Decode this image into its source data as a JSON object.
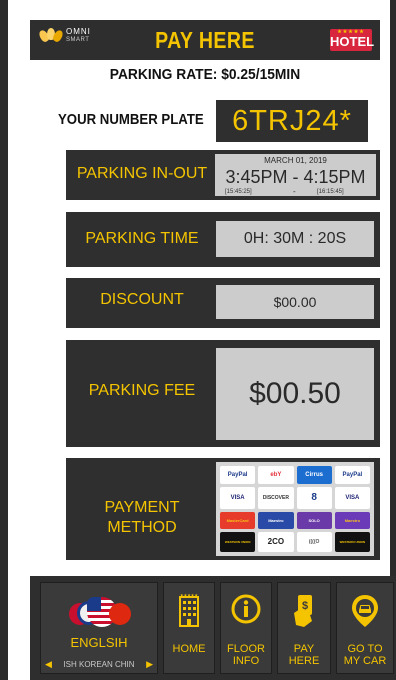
{
  "header": {
    "brand_top": "OMNI",
    "brand_bottom": "SMART",
    "title": "PAY HERE",
    "hotel_badge": "HOTEL"
  },
  "rate": "PARKING RATE: $0.25/15MIN",
  "plate": {
    "label": "YOUR NUMBER PLATE",
    "value": "6TRJ24*"
  },
  "parking_inout": {
    "label": "PARKING IN-OUT",
    "date": "MARCH 01, 2019",
    "times": "3:45PM - 4:15PM",
    "sec_in": "[15:45:25]",
    "sep": "-",
    "sec_out": "[16:15:45]"
  },
  "parking_time": {
    "label": "PARKING TIME",
    "value": "0H: 30M : 20S"
  },
  "discount": {
    "label": "DISCOUNT",
    "value": "$00.00"
  },
  "parking_fee": {
    "label": "PARKING FEE",
    "value": "$00.50"
  },
  "payment": {
    "label_line1": "PAYMENT",
    "label_line2": "METHOD",
    "cards": [
      "PayPal",
      "ebY",
      "Cirrus",
      "PayPal",
      "VISA",
      "DISCOVER",
      "8",
      "VISA",
      "MasterCard",
      "Maestro",
      "SOLO",
      "Maestro",
      "WESTERN UNION",
      "2CO",
      "((((O",
      "WESTERN UNION"
    ]
  },
  "nav": {
    "language": {
      "label": "ENGLSIH",
      "scroller": "ISH KOREAN CHIN"
    },
    "home": "HOME",
    "floor_line1": "FLOOR",
    "floor_line2": "INFO",
    "pay_line1": "PAY",
    "pay_line2": "HERE",
    "car_line1": "GO TO",
    "car_line2": "MY CAR"
  },
  "colors": {
    "accent": "#f4c400",
    "panel": "#2f2f2f",
    "value_bg": "#cccccc",
    "hotel": "#d7263d"
  }
}
